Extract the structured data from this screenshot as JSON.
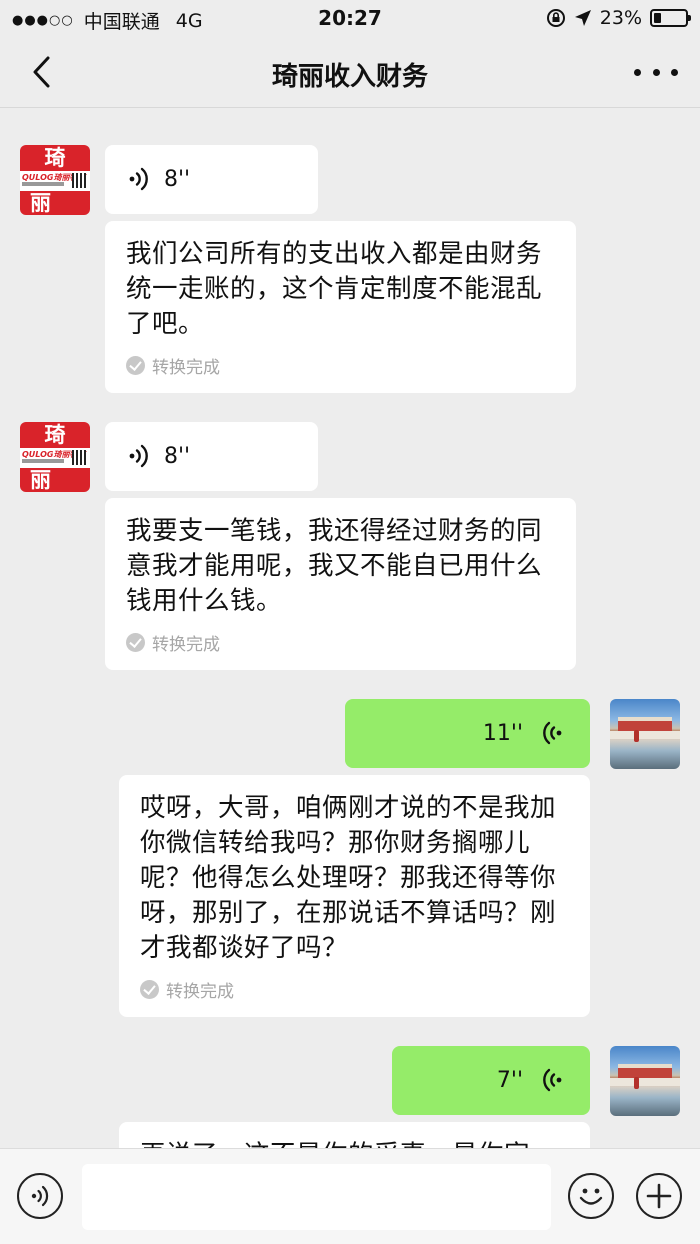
{
  "status_bar": {
    "carrier": "中国联通",
    "network": "4G",
    "time": "20:27",
    "battery_percent": "23%",
    "battery_level": 0.23
  },
  "nav": {
    "title": "琦丽收入财务"
  },
  "contact_avatar": {
    "char_top": "琦",
    "char_bottom": "丽",
    "brand": "QULOG琦丽物流"
  },
  "messages": [
    {
      "voice_duration": "8''",
      "text": "我们公司所有的支出收入都是由财务统一走账的，这个肯定制度不能混乱了吧。",
      "status": "转换完成"
    },
    {
      "voice_duration": "8''",
      "text": "我要支一笔钱，我还得经过财务的同意我才能用呢，我又不能自已用什么钱用什么钱。",
      "status": "转换完成"
    },
    {
      "voice_duration": "11''",
      "text": "哎呀，大哥，咱俩刚才说的不是我加你微信转给我吗？那你财务搁哪儿呢？他得怎么处理呀？那我还得等你呀，那别了，在那说话不算话吗？刚才我都谈好了吗？",
      "status": "转换完成"
    },
    {
      "voice_duration": "7''",
      "text": "再说了，这不是你的采事，是你家"
    }
  ],
  "input_bar": {
    "placeholder": ""
  }
}
